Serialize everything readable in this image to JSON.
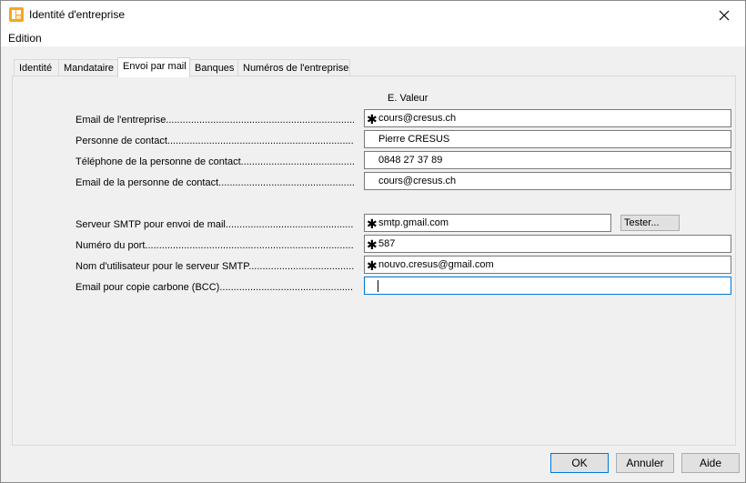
{
  "window": {
    "title": "Identité d'entreprise"
  },
  "menu": {
    "edition": "Edition"
  },
  "tabs": [
    {
      "label": "Identité"
    },
    {
      "label": "Mandataire"
    },
    {
      "label": "Envoi par mail"
    },
    {
      "label": "Banques"
    },
    {
      "label": "Numéros de l'entreprise"
    }
  ],
  "form": {
    "column_header": "E. Valeur",
    "rows": [
      {
        "label": "Email de l'entreprise.................................................................................",
        "value": "cours@cresus.ch",
        "required": "✱"
      },
      {
        "label": "Personne de contact.....................................................................................",
        "value": "Pierre CRESUS",
        "required": ""
      },
      {
        "label": "Téléphone de la personne de contact.......................................................",
        "value": "0848 27 37 89",
        "required": ""
      },
      {
        "label": "Email de la personne de contact................................................................",
        "value": "cours@cresus.ch",
        "required": ""
      },
      {
        "label": "Serveur SMTP pour envoi de mail..............................................................",
        "value": "smtp.gmail.com",
        "required": "✱"
      },
      {
        "label": "Numéro du port.............................................................................................",
        "value": "587",
        "required": "✱"
      },
      {
        "label": "Nom d'utilisateur pour le serveur SMTP..................................................",
        "value": "nouvo.cresus@gmail.com",
        "required": "✱"
      },
      {
        "label": "Email pour copie carbone (BCC)................................................................",
        "value": "",
        "required": ""
      }
    ],
    "tester_label": "Tester..."
  },
  "buttons": {
    "ok": "OK",
    "cancel": "Annuler",
    "help": "Aide"
  }
}
